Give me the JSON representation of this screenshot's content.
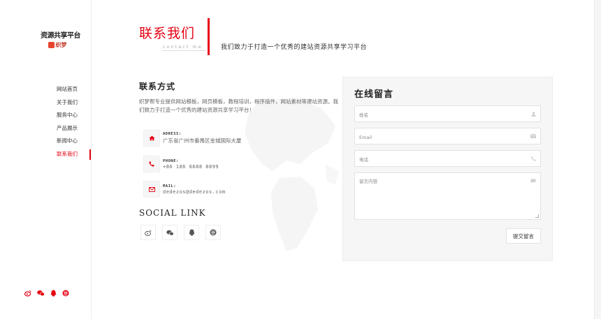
{
  "logo": {
    "main": "资源共享平台",
    "sub": "织梦"
  },
  "nav": {
    "items": [
      {
        "label": "网站首页"
      },
      {
        "label": "关于我们"
      },
      {
        "label": "服务中心"
      },
      {
        "label": "产品展示"
      },
      {
        "label": "新闻中心"
      },
      {
        "label": "联系我们",
        "active": true
      }
    ]
  },
  "header": {
    "title": "联系我们",
    "subtitle": "contact me",
    "slogan": "我们致力于打造一个优秀的建站资源共享学习平台"
  },
  "contact": {
    "title": "联系方式",
    "intro": "织梦帮专业提供网站模板，网页模板，教程培训，程序插件，网站素材等建站资源。我们致力于打造一个优秀的建站资源共享学习平台！",
    "address_label": "ADRESS:",
    "address_value": "广东省广州市番禺区金城国际大厦",
    "phone_label": "PHONE:",
    "phone_value": "+86 186 6688 8899",
    "mail_label": "MAIL:",
    "mail_value": "dedezos@dedezos.com"
  },
  "social": {
    "title": "SOCIAL LINK",
    "icons": [
      "weibo-icon",
      "wechat-icon",
      "qq-icon",
      "douban-icon"
    ]
  },
  "form": {
    "title": "在线留言",
    "name_placeholder": "姓名",
    "email_placeholder": "Email",
    "phone_placeholder": "电话",
    "message_placeholder": "留言内容",
    "submit_label": "提交留言"
  },
  "colors": {
    "accent": "#e60012",
    "panel": "#f6f6f6"
  }
}
